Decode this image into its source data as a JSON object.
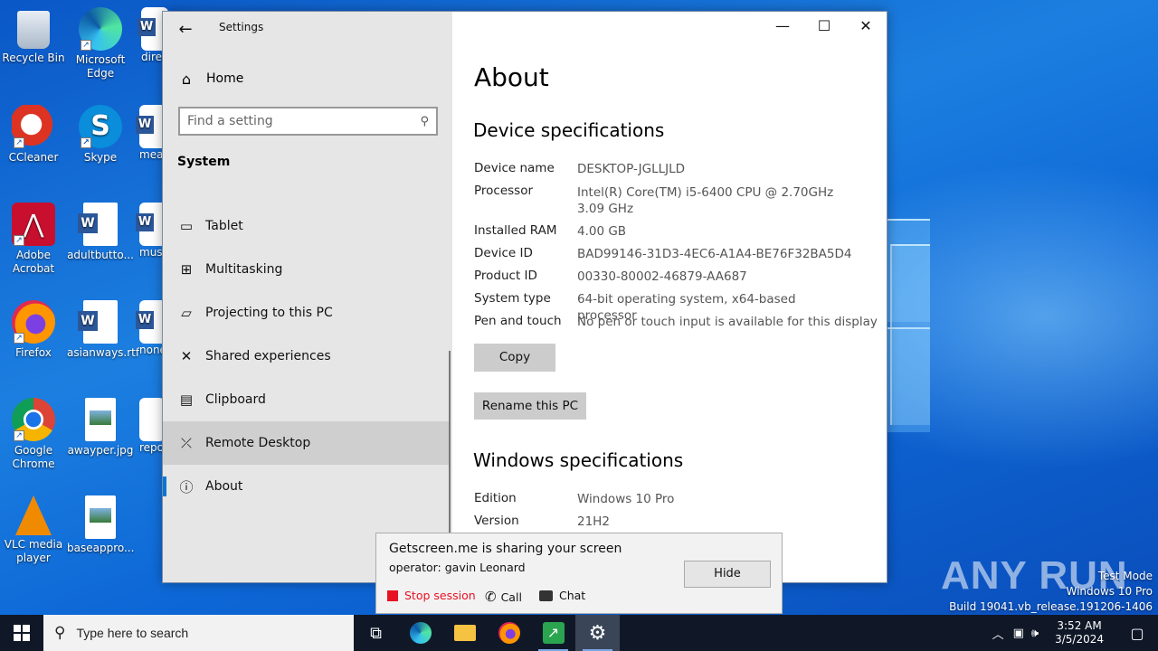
{
  "desktop": {
    "icons": [
      {
        "label": "Recycle Bin"
      },
      {
        "label": "Microsoft Edge"
      },
      {
        "label": "direc"
      },
      {
        "label": "CCleaner"
      },
      {
        "label": "Skype"
      },
      {
        "label": "mear"
      },
      {
        "label": "Adobe Acrobat"
      },
      {
        "label": "adultbutto..."
      },
      {
        "label": "must"
      },
      {
        "label": "Firefox"
      },
      {
        "label": "asianways.rtf"
      },
      {
        "label": "none"
      },
      {
        "label": "Google Chrome"
      },
      {
        "label": "awayper.jpg"
      },
      {
        "label": "repo"
      },
      {
        "label": "VLC media player"
      },
      {
        "label": "baseappro..."
      }
    ]
  },
  "settings": {
    "title": "Settings",
    "home": "Home",
    "search_placeholder": "Find a setting",
    "section": "System",
    "nav_items": [
      {
        "label": "Tablet",
        "icon": "tablet-icon"
      },
      {
        "label": "Multitasking",
        "icon": "multitasking-icon"
      },
      {
        "label": "Projecting to this PC",
        "icon": "projecting-icon"
      },
      {
        "label": "Shared experiences",
        "icon": "shared-experiences-icon"
      },
      {
        "label": "Clipboard",
        "icon": "clipboard-icon"
      },
      {
        "label": "Remote Desktop",
        "icon": "remote-desktop-icon"
      },
      {
        "label": "About",
        "icon": "info-icon"
      }
    ],
    "page_title": "About",
    "device_heading": "Device specifications",
    "device_specs": [
      {
        "label": "Device name",
        "value": "DESKTOP-JGLLJLD"
      },
      {
        "label": "Processor",
        "value": "Intel(R) Core(TM) i5-6400 CPU @ 2.70GHz   3.09 GHz"
      },
      {
        "label": "Installed RAM",
        "value": "4.00 GB"
      },
      {
        "label": "Device ID",
        "value": "BAD99146-31D3-4EC6-A1A4-BE76F32BA5D4"
      },
      {
        "label": "Product ID",
        "value": "00330-80002-46879-AA687"
      },
      {
        "label": "System type",
        "value": "64-bit operating system, x64-based processor"
      },
      {
        "label": "Pen and touch",
        "value": "No pen or touch input is available for this display"
      }
    ],
    "copy_button": "Copy",
    "rename_button": "Rename this PC",
    "windows_heading": "Windows specifications",
    "windows_specs": [
      {
        "label": "Edition",
        "value": "Windows 10 Pro"
      },
      {
        "label": "Version",
        "value": "21H2"
      }
    ]
  },
  "share_banner": {
    "title": "Getscreen.me is sharing your screen",
    "operator": "operator: gavin Leonard",
    "hide_button": "Hide",
    "stop": "Stop session",
    "call": "Call",
    "chat": "Chat",
    "stop_color": "#e81123"
  },
  "watermark": {
    "brand": "ANY RUN",
    "line1": "Test Mode",
    "line2": "Windows 10 Pro",
    "line3": "Build 19041.vb_release.191206-1406"
  },
  "taskbar": {
    "search_placeholder": "Type here to search",
    "time": "3:52 AM",
    "date": "3/5/2024"
  }
}
